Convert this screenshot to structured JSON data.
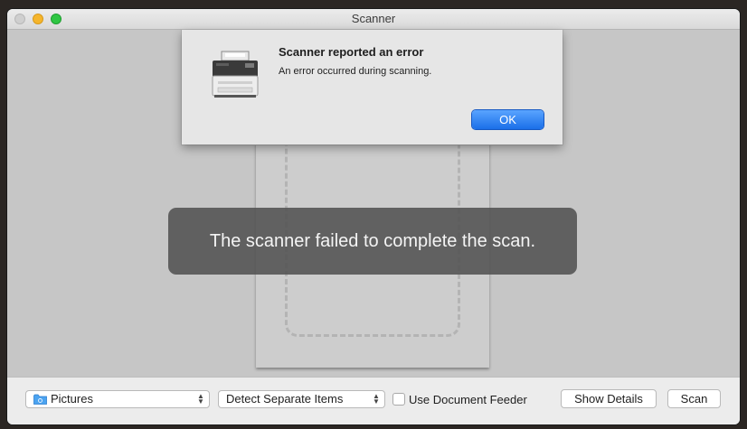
{
  "window": {
    "title": "Scanner"
  },
  "dialog": {
    "title": "Scanner reported an error",
    "message": "An error occurred during scanning.",
    "ok_label": "OK",
    "icon": "printer-icon"
  },
  "toast": {
    "message": "The scanner failed to complete the scan."
  },
  "toolbar": {
    "destination": {
      "selected": "Pictures",
      "icon": "folder-icon"
    },
    "detect": {
      "selected": "Detect Separate Items"
    },
    "feeder": {
      "label": "Use Document Feeder",
      "checked": false
    },
    "show_details_label": "Show Details",
    "scan_label": "Scan"
  },
  "colors": {
    "accent": "#1a6fe8",
    "close": "#cfcfcf",
    "minimize": "#f5b52c",
    "maximize": "#2fc643"
  }
}
